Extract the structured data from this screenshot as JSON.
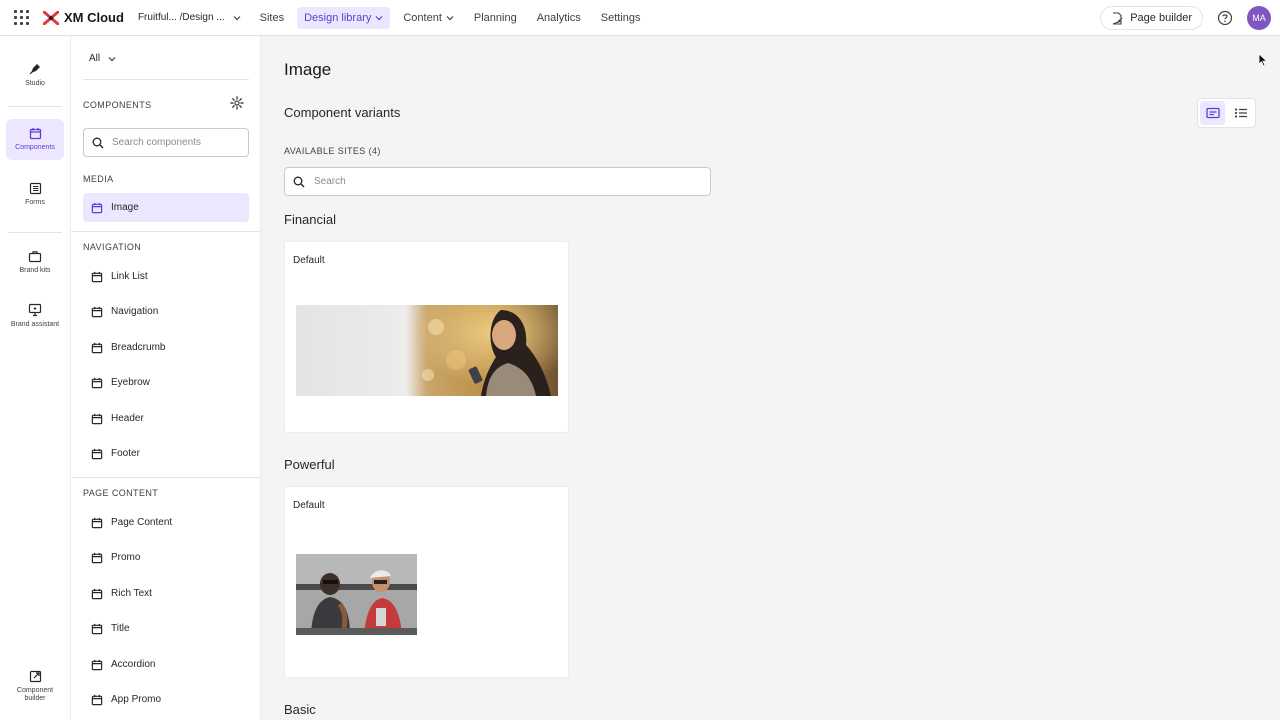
{
  "topbar": {
    "app_name": "XM Cloud",
    "site_breadcrumb": "Fruitful... /Design ...",
    "nav": [
      {
        "label": "Sites",
        "has_menu": false,
        "active": false
      },
      {
        "label": "Design library",
        "has_menu": true,
        "active": true
      },
      {
        "label": "Content",
        "has_menu": true,
        "active": false
      },
      {
        "label": "Planning",
        "has_menu": false,
        "active": false
      },
      {
        "label": "Analytics",
        "has_menu": false,
        "active": false
      },
      {
        "label": "Settings",
        "has_menu": false,
        "active": false
      }
    ],
    "page_builder_label": "Page builder",
    "avatar_initials": "MA"
  },
  "rail": {
    "items": [
      {
        "label": "Studio",
        "icon": "pen-nib-icon"
      },
      {
        "label": "Components",
        "icon": "calendar-icon",
        "active": true
      },
      {
        "label": "Forms",
        "icon": "form-icon"
      },
      {
        "label": "Brand kits",
        "icon": "briefcase-icon"
      },
      {
        "label": "Brand assistant",
        "icon": "monitor-sparkle-icon"
      }
    ],
    "bottom_item": {
      "label": "Component builder",
      "icon": "open-external-icon"
    }
  },
  "panel": {
    "filter_value": "All",
    "components_label": "COMPONENTS",
    "search_placeholder": "Search components",
    "sections": [
      {
        "label": "MEDIA",
        "items": [
          "Image"
        ]
      },
      {
        "label": "NAVIGATION",
        "items": [
          "Link List",
          "Navigation",
          "Breadcrumb",
          "Eyebrow",
          "Header",
          "Footer"
        ]
      },
      {
        "label": "PAGE CONTENT",
        "items": [
          "Page Content",
          "Promo",
          "Rich Text",
          "Title",
          "Accordion",
          "App Promo"
        ]
      }
    ],
    "selected_item": "Image"
  },
  "main": {
    "title": "Image",
    "variants_title": "Component variants",
    "available_sites_label": "AVAILABLE SITES (4)",
    "search_placeholder": "Search",
    "groups": [
      {
        "site": "Financial",
        "variant": "Default"
      },
      {
        "site": "Powerful",
        "variant": "Default"
      },
      {
        "site": "Basic"
      }
    ]
  },
  "colors": {
    "accent": "#5b3fd0",
    "accent_bg": "#ece7ff",
    "avatar": "#7e57c2",
    "logo_red": "#e0393e"
  }
}
